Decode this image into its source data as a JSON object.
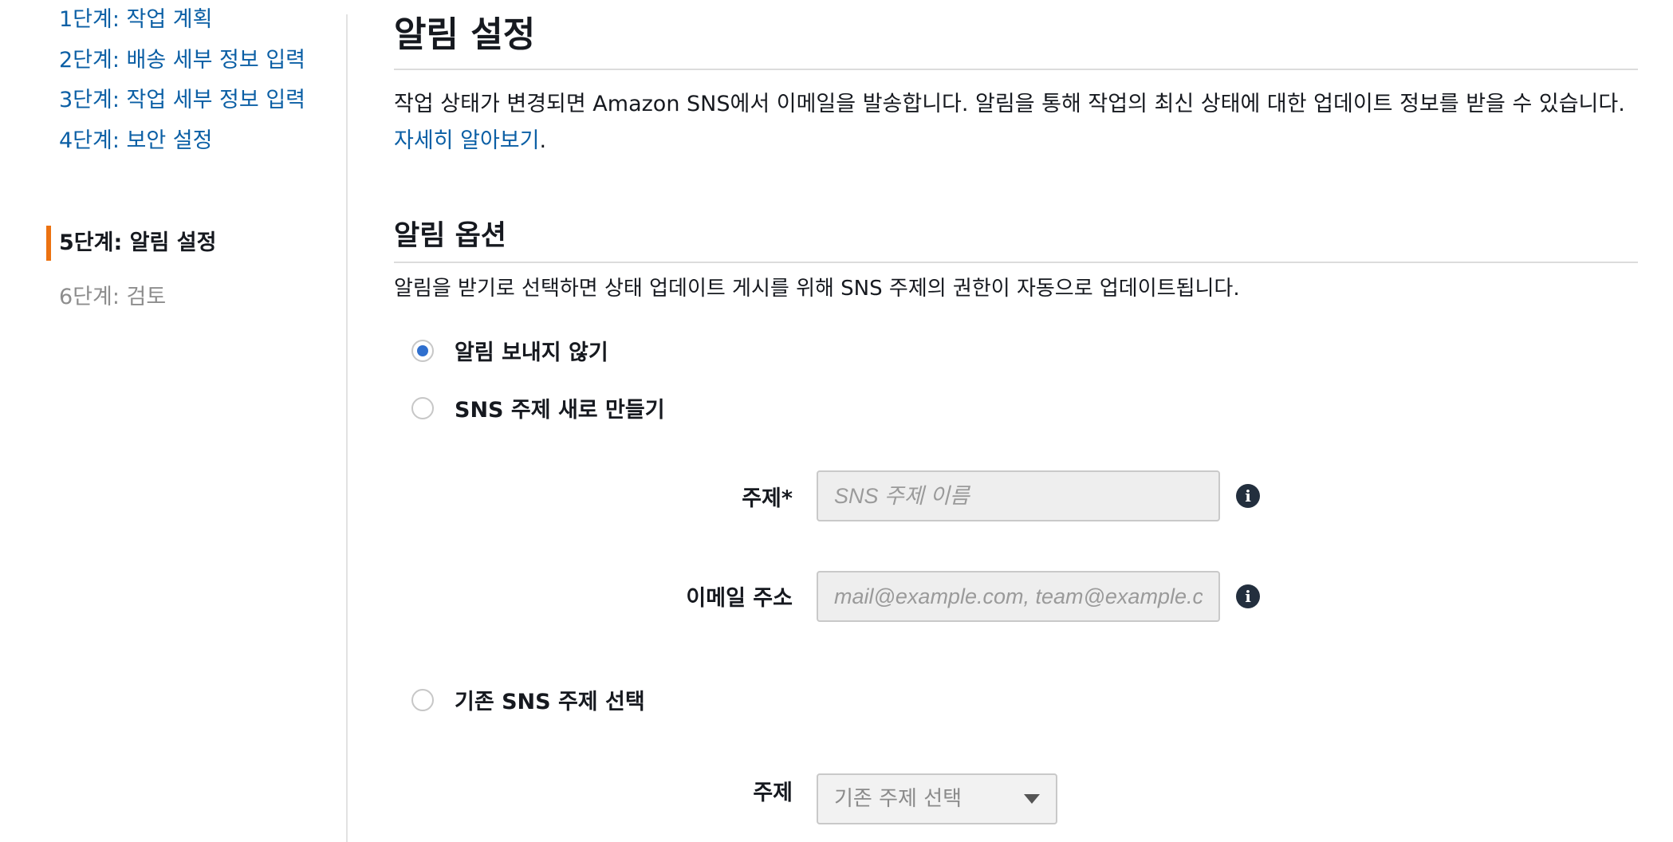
{
  "sidebar": {
    "steps": [
      {
        "label": "1단계: 작업 계획",
        "state": "link"
      },
      {
        "label": "2단계: 배송 세부 정보 입력",
        "state": "link"
      },
      {
        "label": "3단계: 작업 세부 정보 입력",
        "state": "link"
      },
      {
        "label": "4단계: 보안 설정",
        "state": "link"
      },
      {
        "label": "5단계: 알림 설정",
        "state": "active"
      },
      {
        "label": "6단계: 검토",
        "state": "disabled"
      }
    ]
  },
  "main": {
    "title": "알림 설정",
    "description": "작업 상태가 변경되면 Amazon SNS에서 이메일을 발송합니다. 알림을 통해 작업의 최신 상태에 대한 업데이트 정보를 받을 수 있습니다. ",
    "learn_more": "자세히 알아보기",
    "description_end": ".",
    "options_title": "알림 옵션",
    "options_description": "알림을 받기로 선택하면 상태 업데이트 게시를 위해 SNS 주제의 권한이 자동으로 업데이트됩니다.",
    "radio_options": [
      {
        "label": "알림 보내지 않기",
        "checked": true
      },
      {
        "label": "SNS 주제 새로 만들기",
        "checked": false
      },
      {
        "label": "기존 SNS 주제 선택",
        "checked": false
      }
    ],
    "new_topic": {
      "topic_label": "주제*",
      "topic_placeholder": "SNS 주제 이름",
      "email_label": "이메일 주소",
      "email_placeholder": "mail@example.com, team@example.com"
    },
    "existing_topic": {
      "topic_label": "주제",
      "select_value": "기존 주제 선택"
    }
  },
  "icons": {
    "info": "info-icon",
    "select_caret": "caret-down-icon"
  },
  "colors": {
    "link": "#0b5fa5",
    "active_marker": "#ec7211",
    "radio_checked": "#2f6fce",
    "info_icon": "#232f3e"
  }
}
